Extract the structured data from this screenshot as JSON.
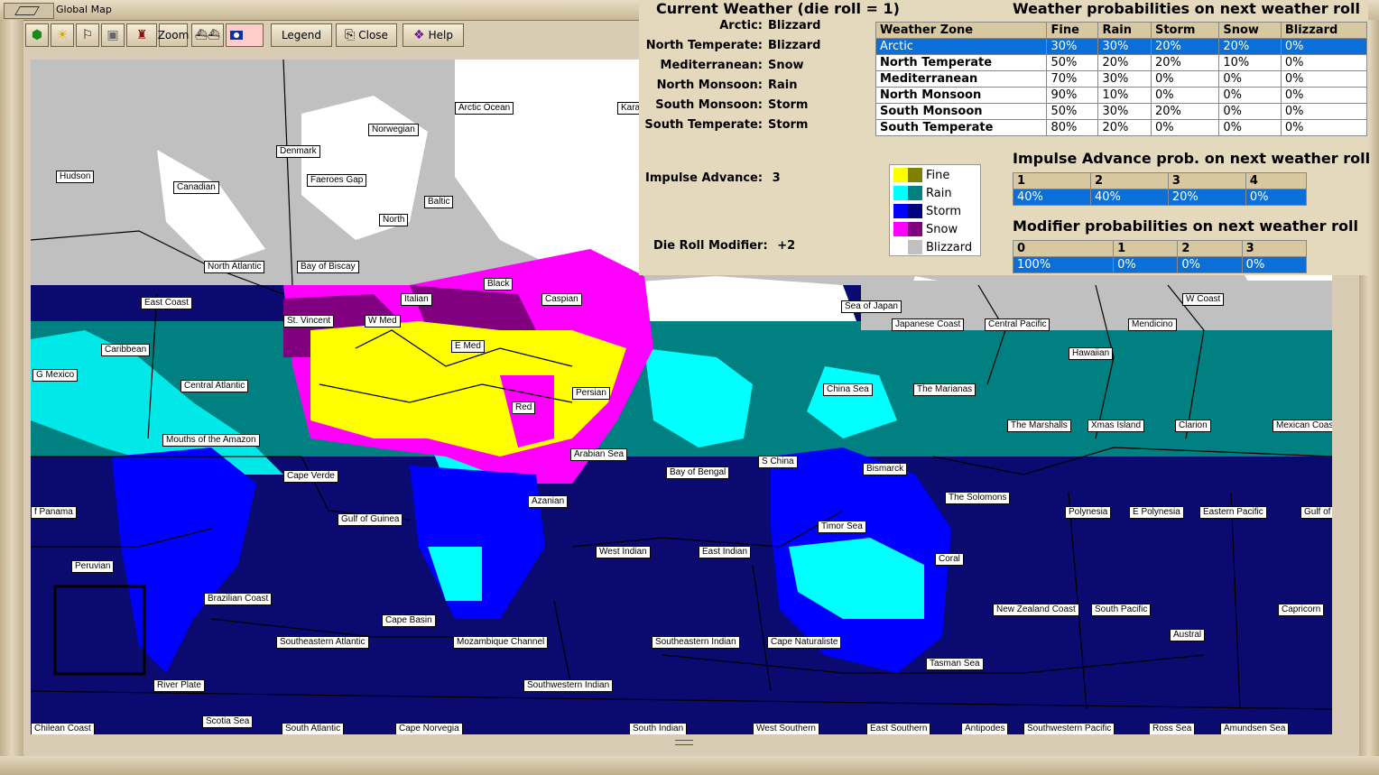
{
  "window": {
    "title": "Global Map"
  },
  "toolbar": {
    "zoom_label": "Zoom",
    "legend_label": "Legend",
    "close_label": "Close",
    "help_label": "Help"
  },
  "current_weather": {
    "title": "Current Weather (die roll = 1)",
    "zones": [
      {
        "zone": "Arctic:",
        "weather": "Blizzard"
      },
      {
        "zone": "North Temperate:",
        "weather": "Blizzard"
      },
      {
        "zone": "Mediterranean:",
        "weather": "Snow"
      },
      {
        "zone": "North Monsoon:",
        "weather": "Rain"
      },
      {
        "zone": "South Monsoon:",
        "weather": "Storm"
      },
      {
        "zone": "South Temperate:",
        "weather": "Storm"
      }
    ],
    "impulse_label": "Impulse Advance:",
    "impulse_value": "3",
    "modifier_label": "Die Roll Modifier:",
    "modifier_value": "+2"
  },
  "legend": [
    {
      "label": "Fine",
      "c1": "#ffff00",
      "c2": "#808000"
    },
    {
      "label": "Rain",
      "c1": "#00ffff",
      "c2": "#008080"
    },
    {
      "label": "Storm",
      "c1": "#0000ff",
      "c2": "#000080"
    },
    {
      "label": "Snow",
      "c1": "#ff00ff",
      "c2": "#800080"
    },
    {
      "label": "Blizzard",
      "c1": "#ffffff",
      "c2": "#c0c0c0"
    }
  ],
  "probabilities": {
    "title": "Weather probabilities on next weather roll",
    "headers": [
      "Weather Zone",
      "Fine",
      "Rain",
      "Storm",
      "Snow",
      "Blizzard"
    ],
    "rows": [
      [
        "Arctic",
        "30%",
        "30%",
        "20%",
        "20%",
        "0%"
      ],
      [
        "North Temperate",
        "50%",
        "20%",
        "20%",
        "10%",
        "0%"
      ],
      [
        "Mediterranean",
        "70%",
        "30%",
        "0%",
        "0%",
        "0%"
      ],
      [
        "North Monsoon",
        "90%",
        "10%",
        "0%",
        "0%",
        "0%"
      ],
      [
        "South Monsoon",
        "50%",
        "30%",
        "20%",
        "0%",
        "0%"
      ],
      [
        "South Temperate",
        "80%",
        "20%",
        "0%",
        "0%",
        "0%"
      ]
    ]
  },
  "impulse_advance": {
    "title": "Impulse Advance prob. on next weather roll",
    "headers": [
      "1",
      "2",
      "3",
      "4"
    ],
    "values": [
      "40%",
      "40%",
      "20%",
      "0%"
    ]
  },
  "modifier": {
    "title": "Modifier probabilities on next weather roll",
    "headers": [
      "0",
      "1",
      "2",
      "3"
    ],
    "values": [
      "100%",
      "0%",
      "0%",
      "0%"
    ]
  },
  "sea_areas": [
    "Arctic Ocean",
    "Kara",
    "Norwegian",
    "Denmark",
    "Hudson",
    "Faeroes Gap",
    "Canadian",
    "Baltic",
    "North",
    "North Atlantic",
    "Bay of Biscay",
    "East Coast",
    "Black",
    "Italian",
    "Caspian",
    "St. Vincent",
    "W Med",
    "E Med",
    "Caribbean",
    "G Mexico",
    "Central Atlantic",
    "Persian",
    "Red",
    "Mouths of the Amazon",
    "Arabian Sea",
    "Cape Verde",
    "Bay of Bengal",
    "S China",
    "Bismarck",
    "Azanian",
    "f Panama",
    "Gulf of Guinea",
    "West Indian",
    "East Indian",
    "Timor Sea",
    "The Solomons",
    "Polynesia",
    "E Polynesia",
    "Eastern Pacific",
    "Gulf of",
    "Peruvian",
    "Coral",
    "Brazilian Coast",
    "New Zealand Coast",
    "South Pacific",
    "Capricorn",
    "Cape Basin",
    "Austral",
    "Southeastern Atlantic",
    "Mozambique Channel",
    "Southeastern Indian",
    "Cape Naturaliste",
    "Tasman Sea",
    "River Plate",
    "Southwestern Indian",
    "Scotia Sea",
    "Chilean Coast",
    "South Atlantic",
    "Cape Norvegia",
    "South Indian",
    "West Southern",
    "East Southern",
    "Antipodes",
    "Southwestern Pacific",
    "Ross Sea",
    "Amundsen Sea",
    "Sea of Japan",
    "Japanese Coast",
    "Central Pacific",
    "Mendicino",
    "W Coast",
    "Hawaiian",
    "China Sea",
    "The Marianas",
    "The Marshalls",
    "Xmas Island",
    "Clarion",
    "Mexican Coast"
  ]
}
